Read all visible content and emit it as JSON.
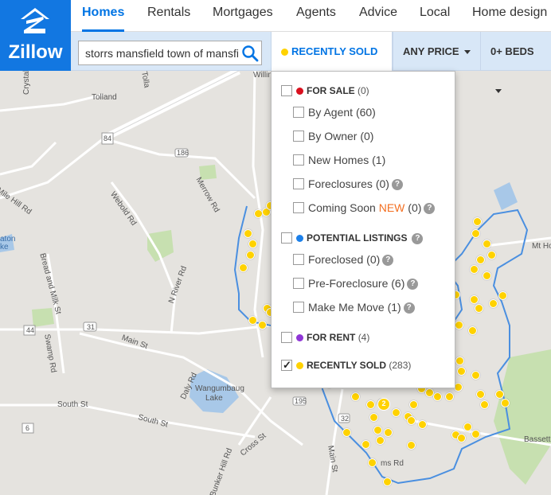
{
  "brand": {
    "name": "Zillow"
  },
  "nav": {
    "items": [
      {
        "label": "Homes",
        "active": true
      },
      {
        "label": "Rentals"
      },
      {
        "label": "Mortgages"
      },
      {
        "label": "Agents"
      },
      {
        "label": "Advice"
      },
      {
        "label": "Local"
      },
      {
        "label": "Home design"
      }
    ]
  },
  "search": {
    "value": "storrs mansfield town of mansfi"
  },
  "filters": {
    "recently_sold": "RECENTLY SOLD",
    "any_price": "ANY PRICE",
    "beds": "0+ BEDS"
  },
  "dropdown": {
    "for_sale": {
      "label": "FOR SALE",
      "count": "(0)"
    },
    "by_agent": {
      "label": "By Agent",
      "count": "(60)"
    },
    "by_owner": {
      "label": "By Owner",
      "count": "(0)"
    },
    "new_homes": {
      "label": "New Homes",
      "count": "(1)"
    },
    "foreclosures": {
      "label": "Foreclosures",
      "count": "(0)"
    },
    "coming_soon": {
      "label": "Coming Soon",
      "new_tag": "NEW",
      "count": "(0)"
    },
    "potential": {
      "label": "POTENTIAL LISTINGS"
    },
    "foreclosed": {
      "label": "Foreclosed",
      "count": "(0)"
    },
    "pre_foreclosure": {
      "label": "Pre-Foreclosure",
      "count": "(6)"
    },
    "make_me_move": {
      "label": "Make Me Move",
      "count": "(1)"
    },
    "for_rent": {
      "label": "FOR RENT",
      "count": "(4)"
    },
    "recently_sold": {
      "label": "RECENTLY SOLD",
      "count": "(283)",
      "checked": true
    }
  },
  "help_glyph": "?",
  "map": {
    "labels": {
      "tolland": "Tolland",
      "crystal": "Crystal",
      "merrow": "Merrow Rd",
      "webold": "Webold Rd",
      "mile_hill": "Mile Hill Rd",
      "bread_milk": "Bread and Milk St",
      "n_river": "N River Rd",
      "main_st": "Main St",
      "swamp": "Swamp Rd",
      "daly": "Daly Rd",
      "wangumbaug": "Wangumbaug",
      "lake": "Lake",
      "south_st": "South St",
      "south_st2": "South St",
      "cross": "Cross St",
      "bunker": "Bunker Hill Rd",
      "main_st2": "Main St",
      "mt_ho": "Mt Ho",
      "bassett": "Bassett F",
      "dams_rd": "ms Rd",
      "willin": "Willin",
      "tolla": "Tolla",
      "rt44": "44",
      "rt31": "31",
      "rt32": "32",
      "rt84": "84",
      "rt186": "186",
      "rt6": "6",
      "rt195": "195",
      "lake_ton": "aton",
      "lake_ke": "ke",
      "cluster2": "2"
    }
  },
  "colors": {
    "brand": "#1277e1",
    "accent": "#0074e4",
    "for_sale": "#d9101e",
    "potential": "#1c80ea",
    "for_rent": "#8f36d6",
    "recently_sold": "#ffd200",
    "boundary": "#4a8fe0"
  }
}
